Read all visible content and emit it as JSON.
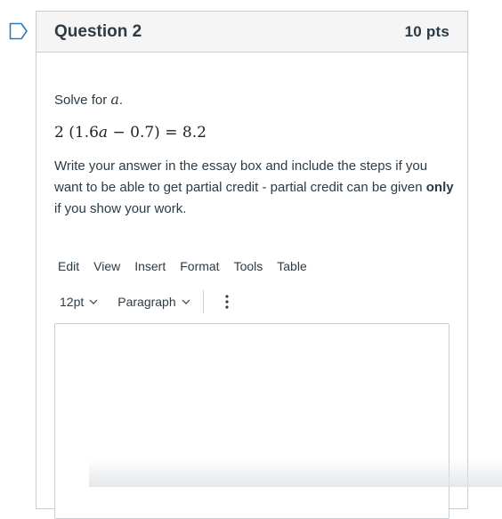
{
  "question": {
    "title": "Question 2",
    "points": "10 pts",
    "prompt_prefix": "Solve for",
    "prompt_var": "a",
    "prompt_suffix": ".",
    "equation": {
      "coef": "2",
      "open": "(",
      "num1": "1.6",
      "var": "a",
      "op": "−",
      "num2": "0.7",
      "close": ")",
      "eq": "=",
      "rhs": "8.2"
    },
    "instructions_part1": "Write your answer in the essay box and include the steps if you want to be able to get partial credit - partial credit can be given ",
    "instructions_bold": "only",
    "instructions_part2": " if you show your work."
  },
  "editor": {
    "menu": [
      "Edit",
      "View",
      "Insert",
      "Format",
      "Tools",
      "Table"
    ],
    "font_size": "12pt",
    "block_format": "Paragraph",
    "content": ""
  },
  "icons": {
    "flag": "bookmark-flag-icon",
    "chevron": "chevron-down-icon",
    "more": "vertical-ellipsis-icon"
  },
  "colors": {
    "flag": "#2b7abc",
    "header_bg": "#f5f5f5",
    "border": "#c7cdd1",
    "text": "#2d3b45"
  }
}
